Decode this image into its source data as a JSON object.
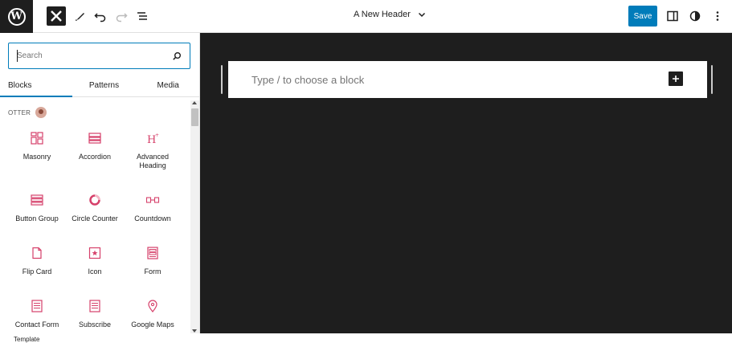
{
  "topbar": {
    "document_title": "A New Header",
    "save_label": "Save"
  },
  "sidebar": {
    "search_placeholder": "Search",
    "tabs": [
      {
        "label": "Blocks"
      },
      {
        "label": "Patterns"
      },
      {
        "label": "Media"
      }
    ],
    "category": "OTTER",
    "blocks": [
      {
        "label": "Masonry",
        "icon": "masonry-icon"
      },
      {
        "label": "Accordion",
        "icon": "accordion-icon"
      },
      {
        "label": "Advanced Heading",
        "icon": "heading-icon"
      },
      {
        "label": "Button Group",
        "icon": "button-group-icon"
      },
      {
        "label": "Circle Counter",
        "icon": "circle-counter-icon"
      },
      {
        "label": "Countdown",
        "icon": "countdown-icon"
      },
      {
        "label": "Flip Card",
        "icon": "flip-card-icon"
      },
      {
        "label": "Icon",
        "icon": "star-icon"
      },
      {
        "label": "Form",
        "icon": "form-icon"
      },
      {
        "label": "Contact Form",
        "icon": "contact-form-icon"
      },
      {
        "label": "Subscribe",
        "icon": "subscribe-icon"
      },
      {
        "label": "Google Maps",
        "icon": "map-pin-icon"
      }
    ]
  },
  "canvas": {
    "placeholder": "Type / to choose a block"
  },
  "footer": {
    "breadcrumb": "Template"
  },
  "colors": {
    "accent": "#007cba",
    "otter_pink": "#d6406a",
    "canvas_bg": "#1e1e1e"
  }
}
